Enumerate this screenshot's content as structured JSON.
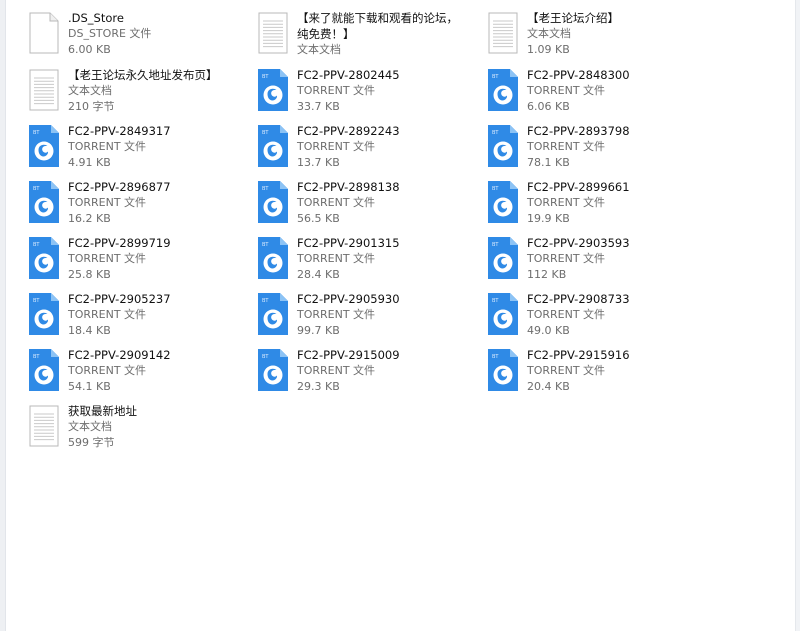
{
  "files": [
    {
      "name": ".DS_Store",
      "type": "DS_STORE 文件",
      "size": "6.00 KB",
      "icon": "blank-file-icon"
    },
    {
      "name": "【来了就能下载和观看的论坛，纯免费！】",
      "type": "文本文档",
      "size": "",
      "icon": "text-file-icon"
    },
    {
      "name": "【老王论坛介绍】",
      "type": "文本文档",
      "size": "1.09 KB",
      "icon": "text-file-icon"
    },
    {
      "name": "【老王论坛永久地址发布页】",
      "type": "文本文档",
      "size": "210 字节",
      "icon": "text-file-icon"
    },
    {
      "name": "FC2-PPV-2802445",
      "type": "TORRENT 文件",
      "size": "33.7 KB",
      "icon": "torrent-file-icon"
    },
    {
      "name": "FC2-PPV-2848300",
      "type": "TORRENT 文件",
      "size": "6.06 KB",
      "icon": "torrent-file-icon"
    },
    {
      "name": "FC2-PPV-2849317",
      "type": "TORRENT 文件",
      "size": "4.91 KB",
      "icon": "torrent-file-icon"
    },
    {
      "name": "FC2-PPV-2892243",
      "type": "TORRENT 文件",
      "size": "13.7 KB",
      "icon": "torrent-file-icon"
    },
    {
      "name": "FC2-PPV-2893798",
      "type": "TORRENT 文件",
      "size": "78.1 KB",
      "icon": "torrent-file-icon"
    },
    {
      "name": "FC2-PPV-2896877",
      "type": "TORRENT 文件",
      "size": "16.2 KB",
      "icon": "torrent-file-icon"
    },
    {
      "name": "FC2-PPV-2898138",
      "type": "TORRENT 文件",
      "size": "56.5 KB",
      "icon": "torrent-file-icon"
    },
    {
      "name": "FC2-PPV-2899661",
      "type": "TORRENT 文件",
      "size": "19.9 KB",
      "icon": "torrent-file-icon"
    },
    {
      "name": "FC2-PPV-2899719",
      "type": "TORRENT 文件",
      "size": "25.8 KB",
      "icon": "torrent-file-icon"
    },
    {
      "name": "FC2-PPV-2901315",
      "type": "TORRENT 文件",
      "size": "28.4 KB",
      "icon": "torrent-file-icon"
    },
    {
      "name": "FC2-PPV-2903593",
      "type": "TORRENT 文件",
      "size": "112 KB",
      "icon": "torrent-file-icon"
    },
    {
      "name": "FC2-PPV-2905237",
      "type": "TORRENT 文件",
      "size": "18.4 KB",
      "icon": "torrent-file-icon"
    },
    {
      "name": "FC2-PPV-2905930",
      "type": "TORRENT 文件",
      "size": "99.7 KB",
      "icon": "torrent-file-icon"
    },
    {
      "name": "FC2-PPV-2908733",
      "type": "TORRENT 文件",
      "size": "49.0 KB",
      "icon": "torrent-file-icon"
    },
    {
      "name": "FC2-PPV-2909142",
      "type": "TORRENT 文件",
      "size": "54.1 KB",
      "icon": "torrent-file-icon"
    },
    {
      "name": "FC2-PPV-2915009",
      "type": "TORRENT 文件",
      "size": "29.3 KB",
      "icon": "torrent-file-icon"
    },
    {
      "name": "FC2-PPV-2915916",
      "type": "TORRENT 文件",
      "size": "20.4 KB",
      "icon": "torrent-file-icon"
    },
    {
      "name": "获取最新地址",
      "type": "文本文档",
      "size": "599 字节",
      "icon": "text-file-icon"
    }
  ],
  "torrent_badge": "BT",
  "colors": {
    "torrent_blue": "#2f8ae6",
    "torrent_fold": "#8cc3f5",
    "text_file_lines": "#c9c9c9",
    "secondary_text": "#6d6d6d"
  }
}
